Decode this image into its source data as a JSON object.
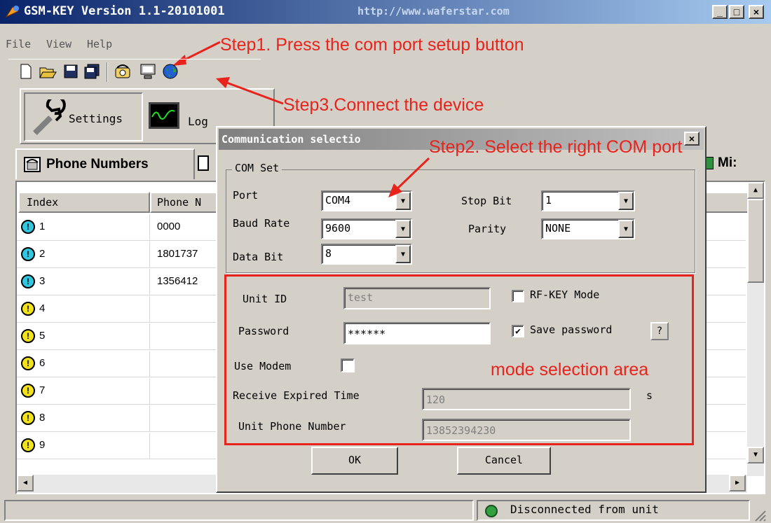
{
  "window": {
    "title": "GSM-KEY Version 1.1-20101001",
    "watermark": "http://www.waferstar.com",
    "title_bar_color": "#0a246a"
  },
  "menu": [
    "File",
    "View",
    "Help"
  ],
  "annotations": {
    "step1": "Step1. Press the com port setup button",
    "step2": "Step2. Select the right COM port",
    "step3": "Step3.Connect the device",
    "mode_area": "mode selection area",
    "color": "#e8231c"
  },
  "nav": {
    "settings": "Settings",
    "log": "Log"
  },
  "tabs": {
    "phone_numbers": "Phone Numbers",
    "misc_partial": "Mi:"
  },
  "table": {
    "headers": [
      "Index",
      "Phone N"
    ],
    "rows": [
      {
        "index": "1",
        "phone": "0000",
        "icon": "cyan"
      },
      {
        "index": "2",
        "phone": "1801737",
        "icon": "cyan"
      },
      {
        "index": "3",
        "phone": "1356412",
        "icon": "cyan"
      },
      {
        "index": "4",
        "phone": "",
        "icon": "yellow"
      },
      {
        "index": "5",
        "phone": "",
        "icon": "yellow"
      },
      {
        "index": "6",
        "phone": "",
        "icon": "yellow"
      },
      {
        "index": "7",
        "phone": "",
        "icon": "yellow"
      },
      {
        "index": "8",
        "phone": "",
        "icon": "yellow"
      },
      {
        "index": "9",
        "phone": "",
        "icon": "yellow"
      }
    ]
  },
  "dialog": {
    "title": "Communication selectio",
    "com_set_label": "COM Set",
    "port_label": "Port",
    "port_value": "COM4",
    "baud_label": "Baud Rate",
    "baud_value": "9600",
    "data_bit_label": "Data Bit",
    "data_bit_value": "8",
    "stop_bit_label": "Stop Bit",
    "stop_bit_value": "1",
    "parity_label": "Parity",
    "parity_value": "NONE",
    "unit_id_label": "Unit ID",
    "unit_id_value": "test",
    "rf_key_label": "RF-KEY Mode",
    "rf_key_checked": false,
    "password_label": "Password",
    "password_value": "******",
    "save_password_label": "Save password",
    "save_password_checked": true,
    "help_button": "?",
    "use_modem_label": "Use Modem",
    "use_modem_checked": false,
    "receive_expired_label": "Receive Expired Time",
    "receive_expired_value": "120",
    "receive_expired_unit": "s",
    "unit_phone_label": "Unit Phone Number",
    "unit_phone_value": "13852394230",
    "ok_label": "OK",
    "cancel_label": "Cancel"
  },
  "status": {
    "text": "Disconnected from unit"
  }
}
